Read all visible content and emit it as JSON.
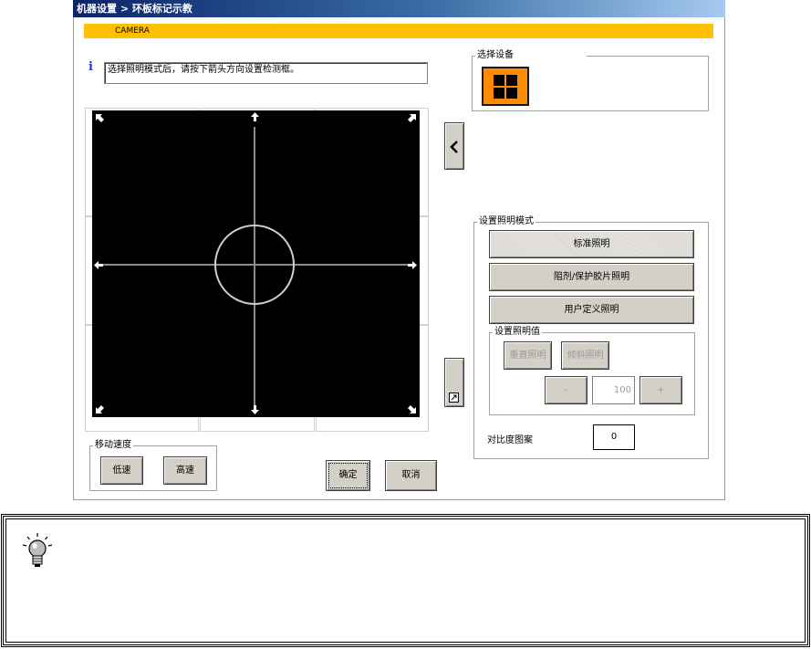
{
  "window": {
    "title": "机器设置 > 环板标记示教",
    "section_header": "CAMERA"
  },
  "instruction": {
    "icon": "info-icon",
    "text": "选择照明模式后，请按下箭头方向设置检测框。"
  },
  "select_device": {
    "label": "选择设备",
    "device_icon": "grid-four-icon",
    "accent_color": "#ff8c00"
  },
  "panel_toggle": {
    "icon": "chevron-left-icon"
  },
  "resize_button": {
    "icon": "resize-icon"
  },
  "lighting_mode": {
    "label": "设置照明模式",
    "buttons": [
      "标准照明",
      "阻剂/保护胶片照明",
      "用户定义照明"
    ],
    "values_group": {
      "label": "设置照明值",
      "vertical_label": "垂直照明",
      "oblique_label": "倾斜照明",
      "minus_label": "-",
      "value": "100",
      "plus_label": "+"
    }
  },
  "contrast": {
    "label": "对比度图案",
    "value": "0"
  },
  "move_speed": {
    "label": "移动速度",
    "slow": "低速",
    "fast": "高速"
  },
  "actions": {
    "ok": "确定",
    "cancel": "取消"
  },
  "tip": {
    "icon": "lightbulb-icon"
  },
  "colors": {
    "header_yellow": "#ffc000",
    "title_blue": "#0a246a",
    "button_face": "#d4d0c8"
  }
}
